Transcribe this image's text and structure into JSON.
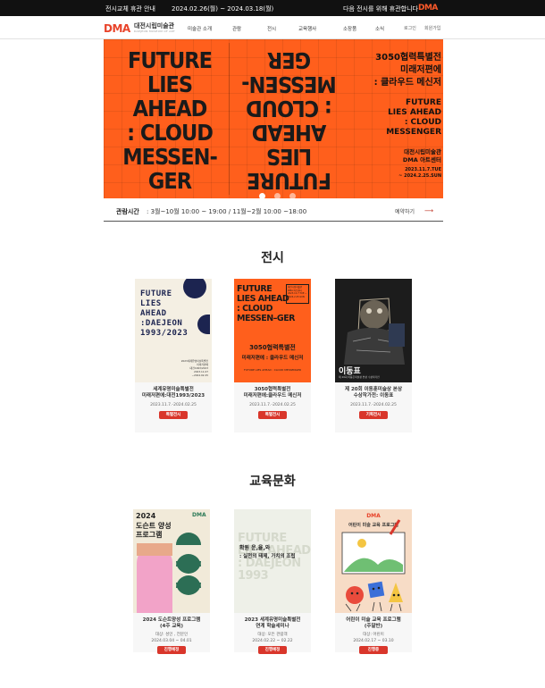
{
  "topbar": {
    "label": "전시교체 휴관 안내",
    "period": "2024.02.26(월) ~ 2024.03.18(월)",
    "message": "다음 전시를 위해 휴관합니다",
    "logo": "DMA"
  },
  "header": {
    "logo": "DMA",
    "name": "대전시립미술관",
    "subname": "DAEJEON MUSEUM OF ART",
    "nav": [
      "미술관 소개",
      "관람",
      "전시",
      "교육행사",
      "소장품",
      "소식"
    ],
    "util": [
      "로그인",
      "회원가입"
    ]
  },
  "hero": {
    "big_text": [
      "FUTURE",
      "LIES AHEAD",
      ": CLOUD",
      "MESSEN-",
      "GER"
    ],
    "kr_line1": "3050협력특별전",
    "kr_line2": "미래저편에",
    "kr_line3": ": 클라우드 메신저",
    "en_line1": "FUTURE",
    "en_line2": "LIES AHEAD",
    "en_line3": ": CLOUD",
    "en_line4": "MESSENGER",
    "venue1": "대전시립미술관",
    "venue2": "DMA 아트센터",
    "date1": "2023.11.7.TUE",
    "date2": "~ 2024.2.25.SUN",
    "slides": 3,
    "active_slide": 1
  },
  "hours": {
    "label": "관람시간",
    "value": ": 3월~10월 10:00 ~ 19:00 / 11월~2월 10:00 ~18:00",
    "booking": "예약하기",
    "arrow": "⟶"
  },
  "exhibitions": {
    "title": "전시",
    "cards": [
      {
        "poster_lines": [
          "FUTURE",
          "LIES",
          "AHEAD",
          ":DAEJEON",
          "1993/2023"
        ],
        "poster_note": [
          "2023세계유명미술특별전",
          "미래저편에",
          ":대전1993/2023",
          "2023.11.07",
          "~2024.02.25"
        ],
        "title1": "세계유명미술특별전",
        "title2": "미래저편에:대전1993/2023",
        "date": "2023.11.7.-2024.02.25",
        "badge": "특별전시"
      },
      {
        "poster_lines": [
          "FUTURE",
          "LIES AHEAD",
          ": CLOUD",
          "MESSEN–GER"
        ],
        "poster_kr": "3050협력특별전",
        "poster_kr2": "미래저편에 : 클라우드 메신저",
        "poster_en": "FUTURE LIES AHEAD : CLOUD MESSENGER",
        "poster_box": "대전시립미술관 DMA 아트센터 2023.11.7.TUE ~ 2024.2.25.SUN",
        "title1": "3050협력특별전",
        "title2": "미래저편에:클라우드 메신저",
        "date": "2023.11.7.-2024.02.25",
        "badge": "특별전시"
      },
      {
        "poster_name": "이동표",
        "poster_small": "제 20회 이동훈미술상 본상 수상작가전",
        "title1": "제 20회 이동훈미술상 본상",
        "title2": "수상작가전: 이동표",
        "date": "2023.11.7.-2024.02.25",
        "badge": "기획전시"
      }
    ]
  },
  "education": {
    "title": "교육문화",
    "cards": [
      {
        "poster_year": "2024",
        "poster_title1": "도슨트 양성",
        "poster_title2": "프로그램",
        "poster_logo": "DMA",
        "title1": "2024 도슨트양성 프로그램",
        "title2": "(4주 교육)",
        "target": "대상: 성인 , 전문인",
        "date": "2024.03.04 ~ 04.01",
        "badge": "진행예정"
      },
      {
        "poster_bg": [
          "FUTURE",
          "LIES AHEAD",
          ": DAEJEON",
          "1993"
        ],
        "poster_main1": "확원 운,율,와",
        "poster_main2": ": 실천의 태제, 가치의 조립",
        "title1": "2023 세계유명미술특별전",
        "title2": "연계 학술세미나",
        "target": "대상: 모든 관람객",
        "date": "2024.02.22 ~ 02.22",
        "badge": "진행예정"
      },
      {
        "poster_logo": "DMA",
        "poster_title": "어린이 미술 교육 프로그램",
        "title1": "어린이 미술 교육 프로그램",
        "title2": "(주말반)",
        "target": "대상: 어린이",
        "date": "2024.02.17 ~ 03.10",
        "badge": "진행중"
      }
    ]
  },
  "colors": {
    "accent": "#ff5f1c",
    "badge": "#d9362b",
    "logo": "#e8432a",
    "topbar": "#111111"
  }
}
